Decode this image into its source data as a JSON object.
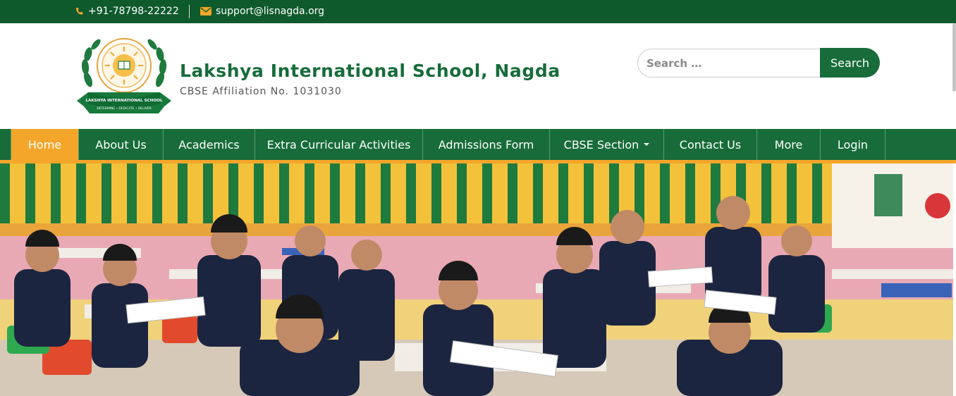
{
  "topbar": {
    "phone": "+91-78798-22222",
    "email": "support@lisnagda.org",
    "phone_icon": "phone-icon",
    "email_icon": "envelope-icon"
  },
  "brand": {
    "name": "Lakshya International School, Nagda",
    "subtitle": "CBSE Affiliation No. 1031030",
    "logo_text": "LAKSHYA INTERNATIONAL SCHOOL",
    "logo_motto": "DETERMINE • DEDICATE • DELIVER"
  },
  "search": {
    "placeholder": "Search …",
    "button_label": "Search"
  },
  "nav": {
    "items": [
      {
        "label": "Home",
        "active": true
      },
      {
        "label": "About Us"
      },
      {
        "label": "Academics"
      },
      {
        "label": "Extra Curricular Activities"
      },
      {
        "label": "Admissions Form"
      },
      {
        "label": "CBSE Section",
        "dropdown": true
      },
      {
        "label": "Contact Us"
      },
      {
        "label": "More"
      },
      {
        "label": "Login"
      }
    ]
  },
  "colors": {
    "primary_green": "#176c3a",
    "dark_green": "#0f5a2d",
    "accent_orange": "#f4a62a"
  },
  "hero": {
    "description_icon": "hero-classroom-image"
  }
}
